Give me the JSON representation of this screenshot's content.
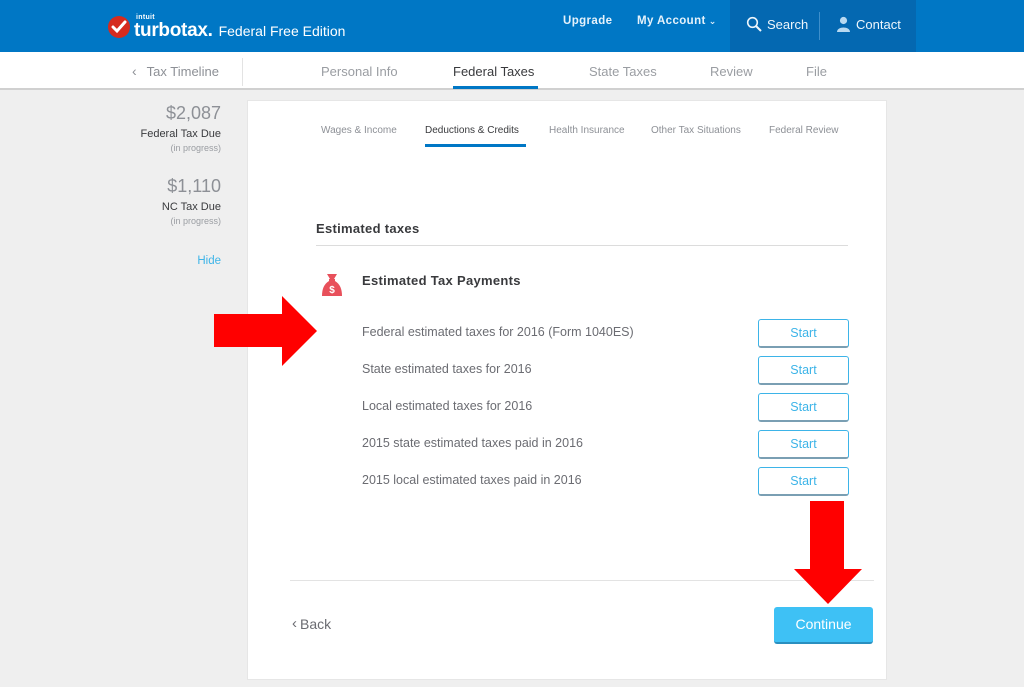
{
  "header": {
    "brand_small": "intuit",
    "brand_name": "turbotax.",
    "edition": "Federal Free Edition",
    "nav": {
      "upgrade": "Upgrade",
      "my_account": "My Account",
      "search": "Search",
      "contact": "Contact"
    }
  },
  "subnav": {
    "back_link": "Tax Timeline",
    "steps": [
      {
        "label": "Personal Info",
        "active": false
      },
      {
        "label": "Federal Taxes",
        "active": true
      },
      {
        "label": "State Taxes",
        "active": false
      },
      {
        "label": "Review",
        "active": false
      },
      {
        "label": "File",
        "active": false
      }
    ]
  },
  "summary": {
    "federal": {
      "amount": "$2,087",
      "label": "Federal Tax Due",
      "note": "(in progress)"
    },
    "state": {
      "amount": "$1,110",
      "label": "NC Tax Due",
      "note": "(in progress)"
    },
    "hide_link": "Hide"
  },
  "section_tabs": [
    {
      "label": "Wages & Income",
      "active": false
    },
    {
      "label": "Deductions & Credits",
      "active": true
    },
    {
      "label": "Health Insurance",
      "active": false
    },
    {
      "label": "Other Tax Situations",
      "active": false
    },
    {
      "label": "Federal Review",
      "active": false
    }
  ],
  "main": {
    "section_title": "Estimated taxes",
    "group_title": "Estimated Tax Payments",
    "group_icon": "money-bag-icon",
    "rows": [
      {
        "label": "Federal estimated taxes for 2016 (Form 1040ES)",
        "button": "Start"
      },
      {
        "label": "State estimated taxes for 2016",
        "button": "Start"
      },
      {
        "label": "Local estimated taxes for 2016",
        "button": "Start"
      },
      {
        "label": "2015 state estimated taxes paid in 2016",
        "button": "Start"
      },
      {
        "label": "2015 local estimated taxes paid in 2016",
        "button": "Start"
      }
    ],
    "back_label": "Back",
    "continue_label": "Continue"
  },
  "colors": {
    "brand_blue": "#0077c5",
    "accent_cyan": "#3ec1f5",
    "logo_red": "#d52b1e",
    "annotation_red": "#ff0000",
    "icon_pink": "#e8505b"
  }
}
